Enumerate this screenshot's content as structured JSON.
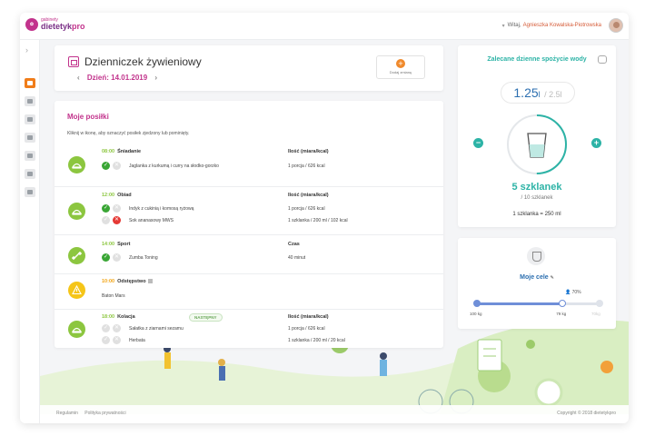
{
  "header": {
    "logo_small": "gabinety",
    "logo_main_a": "dietetyk",
    "logo_main_b": "pro",
    "user_greeting": "Witaj,",
    "user_name": "Agnieszka Kowalska-Piotrowska"
  },
  "diary": {
    "title": "Dzienniczek żywieniowy",
    "date_label": "Dzień:",
    "date_value": "14.01.2019",
    "prev_arrow": "‹",
    "next_arrow": "›",
    "add_meal_label": "Dodaj zmianę"
  },
  "meals": {
    "section_title": "Moje posiłki",
    "hint": "Kliknij w ikonę, aby oznaczyć posiłek zjedzony lub pominięty.",
    "items": [
      {
        "time": "08:00",
        "name": "Śniadanie",
        "column_header": "Ilość (miara/kcal)",
        "rows": [
          {
            "item": "Jaglanka z kurkumą i curry na słodko-gorzko",
            "qty": "1 porcja / 626 kcal"
          }
        ]
      },
      {
        "time": "12:00",
        "name": "Obiad",
        "column_header": "Ilość (miara/kcal)",
        "rows": [
          {
            "item": "Indyk z cukinią i komosą ryżową",
            "qty": "1 porcja / 626 kcal"
          },
          {
            "item": "Sok ananasowy MWS",
            "qty": "1 szklanka / 200 ml / 102 kcal"
          }
        ]
      },
      {
        "time": "14:00",
        "name": "Sport",
        "column_header": "Czas",
        "rows": [
          {
            "item": "Zumba Toning",
            "qty": "40 minut"
          }
        ]
      },
      {
        "time": "10:00",
        "name": "Odstępstwo",
        "note": "Baton Mars"
      },
      {
        "time": "18:00",
        "name": "Kolacja",
        "badge": "NASTĘPNY",
        "column_header": "Ilość (miara/kcal)",
        "rows": [
          {
            "item": "Sałatka z ziarnami sezamu",
            "qty": "1 porcja / 626 kcal"
          },
          {
            "item": "Herbata",
            "qty": "1 szklanka / 200 ml / 20 kcal"
          }
        ]
      }
    ]
  },
  "water": {
    "title": "Zalecane dzienne spożycie wody",
    "current": "1.25",
    "unit": "l",
    "total": "/ 2.5l",
    "glasses": "5 szklanek",
    "glasses_of": "/ 10 szklanek",
    "glass_equiv": "1 szklanka = 250 ml",
    "progress": 0.5,
    "minus": "−",
    "plus": "+"
  },
  "goal": {
    "title": "Moje cele",
    "pct_label": "70%",
    "progress": 0.7,
    "start_label": "100 kg",
    "current_label": "79 kg",
    "end_label": "70kg"
  },
  "footer": {
    "link_1": "Regulamin",
    "link_2": "Polityka prywatności",
    "copyright": "Copyright © 2018 dietetykpro"
  },
  "colors": {
    "brand": "#c2338c",
    "accent_orange": "#f07d1a",
    "meal_green": "#8cc63f",
    "water_teal": "#2db3a6",
    "goal_blue": "#2c6fb0"
  }
}
